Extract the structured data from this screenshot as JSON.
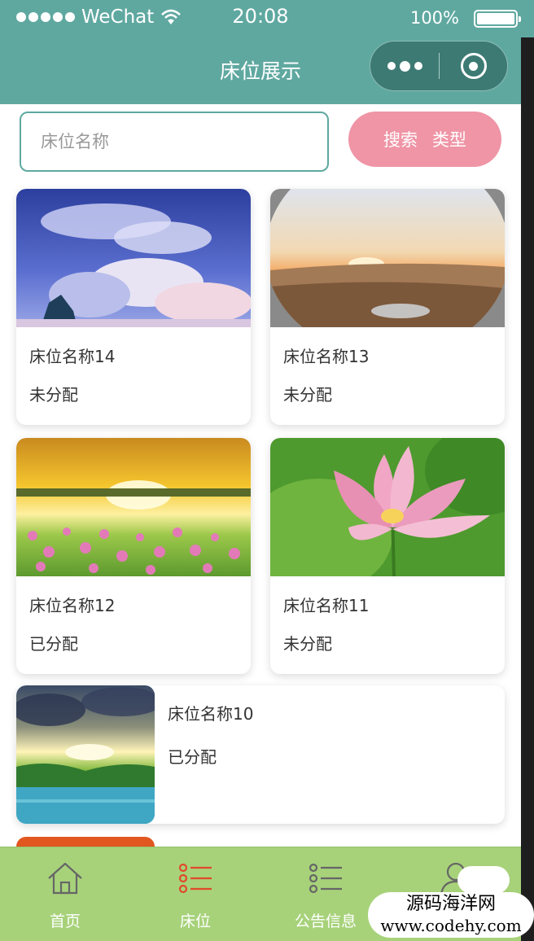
{
  "status_bar": {
    "carrier": "WeChat",
    "time": "20:08",
    "battery": "100%"
  },
  "nav": {
    "title": "床位展示"
  },
  "search": {
    "placeholder": "床位名称",
    "search_label": "搜索",
    "type_label": "类型"
  },
  "beds": [
    {
      "name": "床位名称14",
      "status": "未分配",
      "image": "sky-clouds"
    },
    {
      "name": "床位名称13",
      "status": "未分配",
      "image": "desert-sunset"
    },
    {
      "name": "床位名称12",
      "status": "已分配",
      "image": "flower-field-sunset"
    },
    {
      "name": "床位名称11",
      "status": "未分配",
      "image": "lotus-flower"
    },
    {
      "name": "床位名称10",
      "status": "已分配",
      "image": "lake-sunrise"
    }
  ],
  "tab_bar": {
    "items": [
      {
        "label": "首页",
        "icon": "home-icon",
        "color": "#ffffff"
      },
      {
        "label": "床位",
        "icon": "list-icon",
        "color": "#e04a2a"
      },
      {
        "label": "公告信息",
        "icon": "list-icon",
        "color": "#666666"
      },
      {
        "label": "",
        "icon": "user-icon",
        "color": "#666666"
      }
    ]
  },
  "watermark": {
    "line1": "源码海洋网",
    "line2": "www.codehy.com"
  },
  "colors": {
    "primary": "#5fa8a0",
    "search_button": "#ef95a6",
    "tab_bar": "#a7d27a",
    "active_tab": "#e04a2a"
  }
}
